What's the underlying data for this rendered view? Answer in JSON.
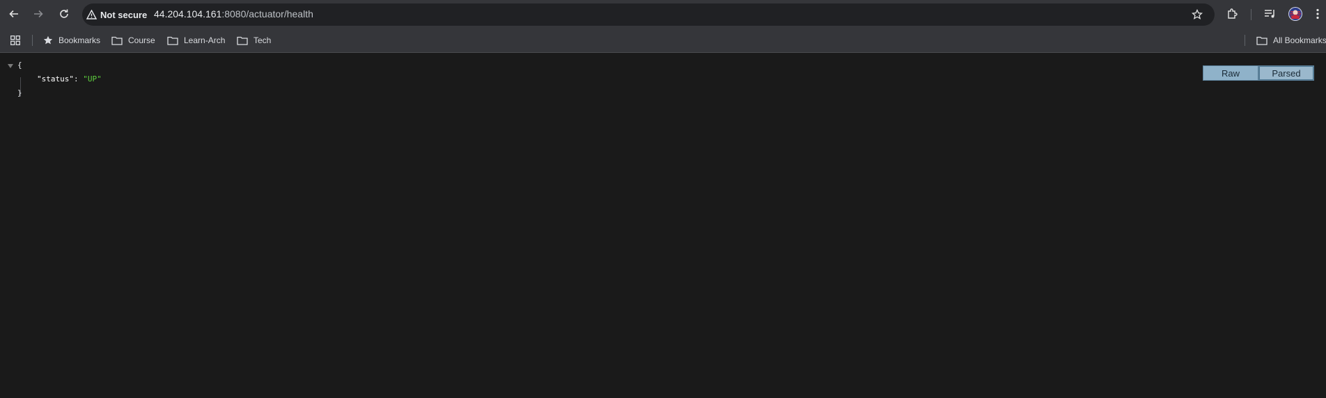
{
  "browser": {
    "security_label": "Not secure",
    "url_host": "44.204.104.161",
    "url_rest": ":8080/actuator/health",
    "icons": [
      "back-arrow-icon",
      "forward-arrow-icon",
      "reload-icon",
      "warning-triangle-icon",
      "star-icon",
      "extensions-icon",
      "media-queue-icon",
      "profile-avatar-icon",
      "kebab-menu-icon"
    ]
  },
  "bookmarks": {
    "items": [
      {
        "label": "Bookmarks",
        "icon": "star-icon"
      },
      {
        "label": "Course",
        "icon": "folder-icon"
      },
      {
        "label": "Learn-Arch",
        "icon": "folder-icon"
      },
      {
        "label": "Tech",
        "icon": "folder-icon"
      }
    ],
    "all_label": "All Bookmarks"
  },
  "json_viewer": {
    "open_brace": "{",
    "close_brace": "}",
    "key": "\"status\"",
    "colon": ": ",
    "value": "\"UP\"",
    "raw_label": "Raw",
    "parsed_label": "Parsed"
  },
  "colors": {
    "toolbar": "#35363a",
    "omnibox": "#202124",
    "page_bg": "#1a1a1a",
    "string_value": "#5fcf3f",
    "toggle_button": "#8fb2c9"
  }
}
